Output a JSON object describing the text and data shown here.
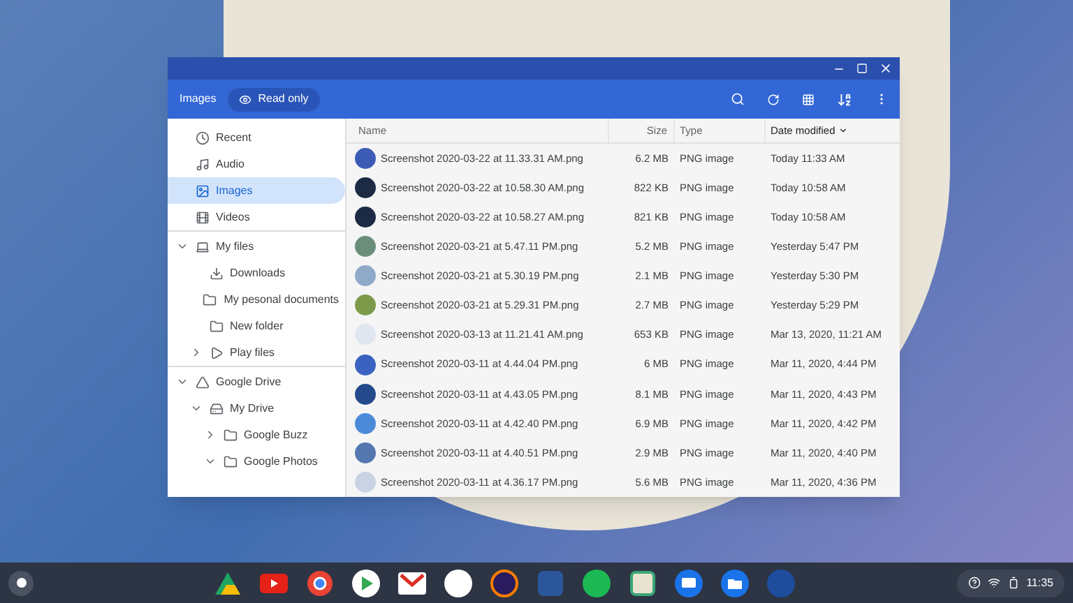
{
  "toolbar": {
    "breadcrumb": "Images",
    "badge": "Read only"
  },
  "sidebar": {
    "groups": [
      {
        "items": [
          {
            "label": "Recent",
            "kind": "clock",
            "selected": false
          },
          {
            "label": "Audio",
            "kind": "audio",
            "selected": false
          },
          {
            "label": "Images",
            "kind": "image",
            "selected": true
          },
          {
            "label": "Videos",
            "kind": "video",
            "selected": false
          }
        ]
      },
      {
        "items": [
          {
            "label": "My files",
            "kind": "laptop",
            "selected": false,
            "expanded": true,
            "children": [
              {
                "label": "Downloads",
                "kind": "download",
                "selected": false
              },
              {
                "label": "My pesonal documents",
                "kind": "folder",
                "selected": false
              },
              {
                "label": "New folder",
                "kind": "folder",
                "selected": false
              },
              {
                "label": "Play files",
                "kind": "play",
                "selected": false,
                "expanded": false
              }
            ]
          }
        ]
      },
      {
        "items": [
          {
            "label": "Google Drive",
            "kind": "drive",
            "selected": false,
            "expanded": true,
            "children": [
              {
                "label": "My Drive",
                "kind": "mydrive",
                "selected": false,
                "expanded": true,
                "children": [
                  {
                    "label": "Google Buzz",
                    "kind": "folder",
                    "selected": false,
                    "expanded": false
                  },
                  {
                    "label": "Google Photos",
                    "kind": "folder",
                    "selected": false,
                    "expanded": true
                  }
                ]
              }
            ]
          }
        ]
      }
    ]
  },
  "table": {
    "columns": [
      {
        "label": "Name",
        "sorted": false
      },
      {
        "label": "Size",
        "sorted": false
      },
      {
        "label": "Type",
        "sorted": false
      },
      {
        "label": "Date modified",
        "sorted": true
      }
    ],
    "rows": [
      {
        "name": "Screenshot 2020-03-22 at 11.33.31 AM.png",
        "size": "6.2 MB",
        "type": "PNG image",
        "date": "Today 11:33 AM",
        "color": "#3b5bb5"
      },
      {
        "name": "Screenshot 2020-03-22 at 10.58.30 AM.png",
        "size": "822 KB",
        "type": "PNG image",
        "date": "Today 10:58 AM",
        "color": "#1c2a44"
      },
      {
        "name": "Screenshot 2020-03-22 at 10.58.27 AM.png",
        "size": "821 KB",
        "type": "PNG image",
        "date": "Today 10:58 AM",
        "color": "#1c2a44"
      },
      {
        "name": "Screenshot 2020-03-21 at 5.47.11 PM.png",
        "size": "5.2 MB",
        "type": "PNG image",
        "date": "Yesterday 5:47 PM",
        "color": "#6b8e7a"
      },
      {
        "name": "Screenshot 2020-03-21 at 5.30.19 PM.png",
        "size": "2.1 MB",
        "type": "PNG image",
        "date": "Yesterday 5:30 PM",
        "color": "#8fa9c9"
      },
      {
        "name": "Screenshot 2020-03-21 at 5.29.31 PM.png",
        "size": "2.7 MB",
        "type": "PNG image",
        "date": "Yesterday 5:29 PM",
        "color": "#7c9a4a"
      },
      {
        "name": "Screenshot 2020-03-13 at 11.21.41 AM.png",
        "size": "653 KB",
        "type": "PNG image",
        "date": "Mar 13, 2020, 11:21 AM",
        "color": "#dfe6ef"
      },
      {
        "name": "Screenshot 2020-03-11 at 4.44.04 PM.png",
        "size": "6 MB",
        "type": "PNG image",
        "date": "Mar 11, 2020, 4:44 PM",
        "color": "#3a62c0"
      },
      {
        "name": "Screenshot 2020-03-11 at 4.43.05 PM.png",
        "size": "8.1 MB",
        "type": "PNG image",
        "date": "Mar 11, 2020, 4:43 PM",
        "color": "#244a8c"
      },
      {
        "name": "Screenshot 2020-03-11 at 4.42.40 PM.png",
        "size": "6.9 MB",
        "type": "PNG image",
        "date": "Mar 11, 2020, 4:42 PM",
        "color": "#4b8ad8"
      },
      {
        "name": "Screenshot 2020-03-11 at 4.40.51 PM.png",
        "size": "2.9 MB",
        "type": "PNG image",
        "date": "Mar 11, 2020, 4:40 PM",
        "color": "#5577b0"
      },
      {
        "name": "Screenshot 2020-03-11 at 4.36.17 PM.png",
        "size": "5.6 MB",
        "type": "PNG image",
        "date": "Mar 11, 2020, 4:36 PM",
        "color": "#c9d3e3"
      }
    ]
  },
  "shelf": {
    "apps": [
      {
        "kind": "triangle"
      },
      {
        "kind": "video"
      },
      {
        "kind": "ring"
      },
      {
        "kind": "play"
      },
      {
        "kind": "mail"
      },
      {
        "kind": "white-circle"
      },
      {
        "kind": "purple-circle"
      },
      {
        "kind": "doc"
      },
      {
        "kind": "green-circle"
      },
      {
        "kind": "tile"
      },
      {
        "kind": "chat"
      },
      {
        "kind": "folder"
      },
      {
        "kind": "dark-circle"
      }
    ],
    "time": "11:35"
  }
}
